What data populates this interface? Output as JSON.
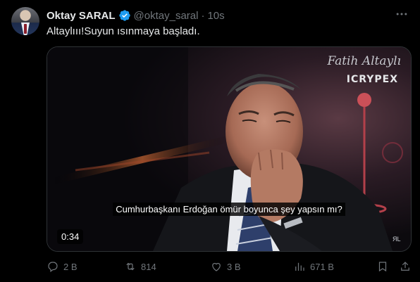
{
  "author": {
    "display_name": "Oktay SARAL",
    "handle": "@oktay_saral",
    "separator": "·",
    "time": "10s",
    "verified_color": "#1d9bf0"
  },
  "tweet": {
    "text": "Altaylııı!Suyun ısınmaya başladı."
  },
  "video": {
    "watermark_name": "Fatih Altaylı",
    "watermark_brand": "ICRYPEX",
    "subtitle": "Cumhurbaşkanı Erdoğan ömür boyunca şey yapsın mı?",
    "duration": "0:34",
    "corner_logo": "ЯL"
  },
  "actions": {
    "replies": "2 B",
    "reposts": "814",
    "likes": "3 B",
    "views": "671 B"
  },
  "icons": {
    "more": "more-icon",
    "reply": "reply-icon",
    "repost": "repost-icon",
    "like": "like-icon",
    "views": "views-icon",
    "bookmark": "bookmark-icon",
    "share": "share-icon",
    "verified": "verified-badge-icon"
  }
}
